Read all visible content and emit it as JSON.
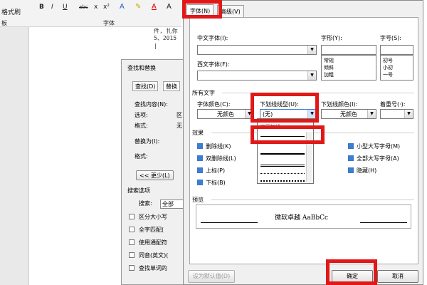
{
  "ribbon": {
    "format_painter": "格式刷",
    "bold": "B",
    "italic": "I",
    "underline": "U",
    "strikethrough": "abc",
    "subscript": "x",
    "superscript": "x²",
    "font_group_label": "字体",
    "clipboard_label": "板"
  },
  "document": {
    "line1": "件, 扎你",
    "line2": "5、2015",
    "cursor": "|"
  },
  "find_dialog": {
    "title": "查找和替换",
    "tab_find": "查找(D)",
    "tab_replace": "替换",
    "find_label": "查找内容(N):",
    "options_label": "选项:",
    "options_value": "区",
    "format_label": "格式:",
    "format_value": "无",
    "replace_label": "替换为(I):",
    "replace_format_label": "格式:",
    "less_button": "<< 更少(L)",
    "search_options_label": "搜索选项",
    "search_label": "搜索:",
    "search_value": "全部",
    "checkboxes": [
      "区分大小写",
      "全字匹配(",
      "使用通配符",
      "同音(英文)(",
      "查找单词的"
    ]
  },
  "font_dialog": {
    "tab_font": "字体(N)",
    "tab_advanced": "高级(V)",
    "cn_font_label": "中文字体(I):",
    "cn_font_value": "",
    "style_label": "字形(Y):",
    "style_value": "",
    "style_options": [
      "常规",
      "倾斜",
      "加粗"
    ],
    "size_label": "字号(S):",
    "size_value": "",
    "size_options": [
      "初号",
      "小初",
      "一号"
    ],
    "western_font_label": "西文字体(F):",
    "western_font_value": "",
    "all_text_label": "所有文字",
    "font_color_label": "字体颜色(C):",
    "font_color_value": "无颜色",
    "underline_style_label": "下划线线型(U):",
    "underline_style_value": "(无)",
    "underline_color_label": "下划线颜色(I):",
    "underline_color_value": "无颜色",
    "emphasis_label": "着重号(·):",
    "emphasis_value": "",
    "dropdown_partial_text": "字下加线",
    "effects_label": "效果",
    "effects_left": [
      "删除线(K)",
      "双删除线(L)",
      "上标(P)",
      "下标(B)"
    ],
    "effects_right": [
      "小型大写字母(M)",
      "全部大写字母(A)",
      "隐藏(H)"
    ],
    "preview_label": "预览",
    "preview_text": "微软卓越  AaBbCc",
    "set_default_button": "设为默认值(D)",
    "ok_button": "确定",
    "cancel_button": "取消"
  },
  "colors": {
    "highlight_red": "#e01818",
    "checkbox_blue": "#3c7fd1"
  }
}
